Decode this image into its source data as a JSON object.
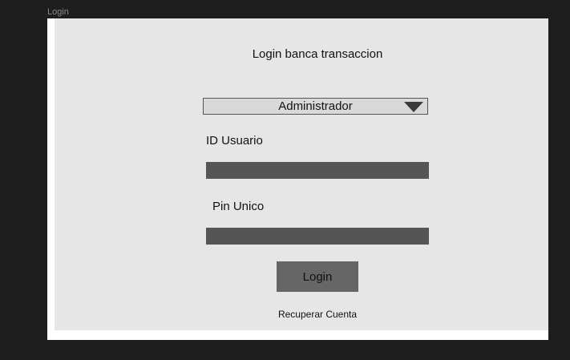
{
  "frame": {
    "label": "Login"
  },
  "login": {
    "title": "Login banca transaccion",
    "role_select": {
      "selected": "Administrador"
    },
    "user_id": {
      "label": "ID Usuario",
      "value": ""
    },
    "pin": {
      "label": "Pin Unico",
      "value": ""
    },
    "login_button": "Login",
    "recover_link": "Recuperar Cuenta"
  },
  "colors": {
    "background": "#1e1e1e",
    "panel": "#e6e6e6",
    "input_fill": "#555555",
    "button_fill": "#666666",
    "select_fill": "#d9d9d9"
  },
  "icons": {
    "select_arrow": "triangle-down-icon"
  }
}
